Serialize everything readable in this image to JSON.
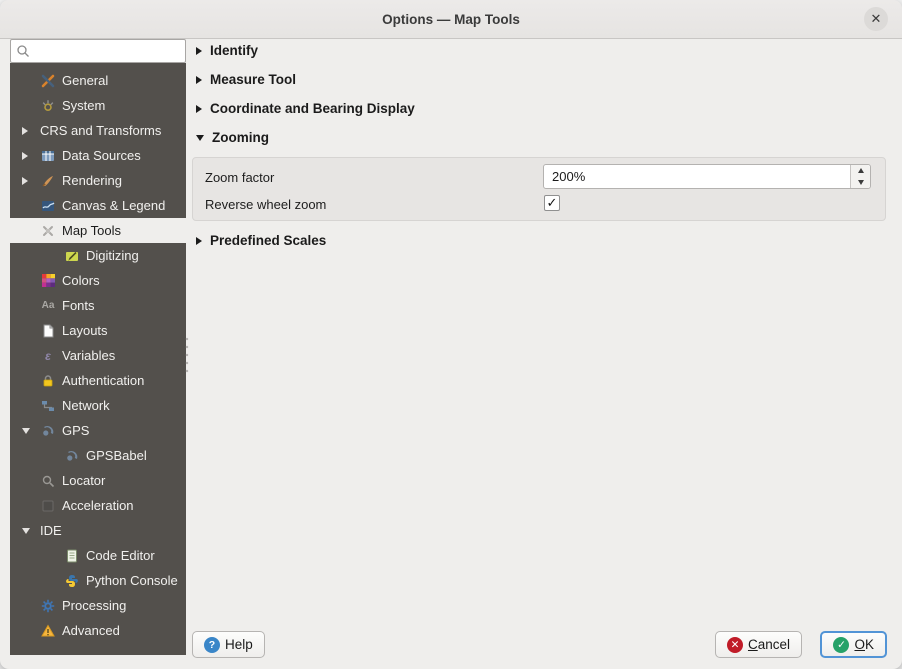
{
  "window": {
    "title": "Options — Map Tools",
    "close_glyph": "✕"
  },
  "sidebar": {
    "search_placeholder": "",
    "items": [
      {
        "label": "General"
      },
      {
        "label": "System"
      },
      {
        "label": "CRS and Transforms",
        "arrow": "collapsed"
      },
      {
        "label": "Data Sources",
        "arrow": "collapsed"
      },
      {
        "label": "Rendering",
        "arrow": "collapsed"
      },
      {
        "label": "Canvas & Legend"
      },
      {
        "label": "Map Tools",
        "selected": true
      },
      {
        "label": "Digitizing",
        "child": true
      },
      {
        "label": "Colors"
      },
      {
        "label": "Fonts"
      },
      {
        "label": "Layouts"
      },
      {
        "label": "Variables"
      },
      {
        "label": "Authentication"
      },
      {
        "label": "Network"
      },
      {
        "label": "GPS",
        "arrow": "expanded"
      },
      {
        "label": "GPSBabel",
        "child": true
      },
      {
        "label": "Locator"
      },
      {
        "label": "Acceleration"
      },
      {
        "label": "IDE",
        "arrow": "expanded"
      },
      {
        "label": "Code Editor",
        "child": true
      },
      {
        "label": "Python Console",
        "child": true
      },
      {
        "label": "Processing"
      },
      {
        "label": "Advanced"
      }
    ],
    "icon_glyphs": {
      "fonts": "Aa",
      "variables": "ε"
    }
  },
  "main": {
    "sections": [
      {
        "label": "Identify",
        "state": "collapsed"
      },
      {
        "label": "Measure Tool",
        "state": "collapsed"
      },
      {
        "label": "Coordinate and Bearing Display",
        "state": "collapsed"
      },
      {
        "label": "Zooming",
        "state": "expanded"
      },
      {
        "label": "Predefined Scales",
        "state": "collapsed"
      }
    ],
    "zooming": {
      "zoom_factor_label": "Zoom factor",
      "zoom_factor_value": "200%",
      "reverse_wheel_zoom_label": "Reverse wheel zoom",
      "reverse_wheel_zoom_checked": true,
      "check_glyph": "✓"
    }
  },
  "footer": {
    "help_label": "Help",
    "help_glyph": "?",
    "cancel_label": "Cancel",
    "cancel_glyph": "✕",
    "ok_label": "OK",
    "ok_glyph": "✓",
    "help_color": "#3a86c8",
    "cancel_color": "#c01c28",
    "ok_color": "#26a269"
  }
}
